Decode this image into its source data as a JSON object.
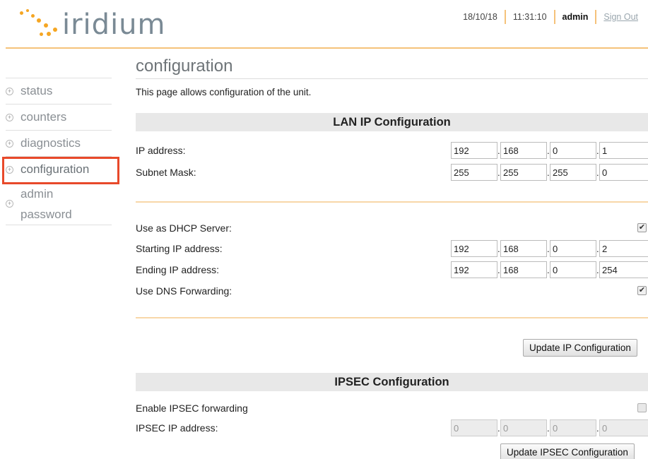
{
  "header": {
    "logo_text": "iridium",
    "date": "18/10/18",
    "time": "11:31:10",
    "user": "admin",
    "sign_out": "Sign Out"
  },
  "sidebar": {
    "items": [
      {
        "label": "status"
      },
      {
        "label": "counters"
      },
      {
        "label": "diagnostics"
      },
      {
        "label": "configuration"
      },
      {
        "label_line1": "admin",
        "label_line2": "password"
      }
    ],
    "active": "configuration"
  },
  "page": {
    "title": "configuration",
    "intro": "This page allows configuration of the unit."
  },
  "lan": {
    "heading": "LAN IP Configuration",
    "ip_label": "IP address:",
    "ip": [
      "192",
      "168",
      "0",
      "1"
    ],
    "subnet_label": "Subnet Mask:",
    "subnet": [
      "255",
      "255",
      "255",
      "0"
    ],
    "dhcp_label": "Use as DHCP Server:",
    "dhcp_checked": true,
    "start_label": "Starting IP address:",
    "start_ip": [
      "192",
      "168",
      "0",
      "2"
    ],
    "end_label": "Ending IP address:",
    "end_ip": [
      "192",
      "168",
      "0",
      "254"
    ],
    "dns_label": "Use DNS Forwarding:",
    "dns_checked": true,
    "update_button": "Update IP Configuration"
  },
  "ipsec": {
    "heading": "IPSEC Configuration",
    "enable_label": "Enable IPSEC forwarding",
    "enable_checked": false,
    "ip_label": "IPSEC IP address:",
    "ip": [
      "0",
      "0",
      "0",
      "0"
    ],
    "update_button": "Update IPSEC Configuration"
  },
  "colors": {
    "accent": "#f5a623",
    "highlight": "#e8492a",
    "section_bg": "#e8e8e8"
  }
}
